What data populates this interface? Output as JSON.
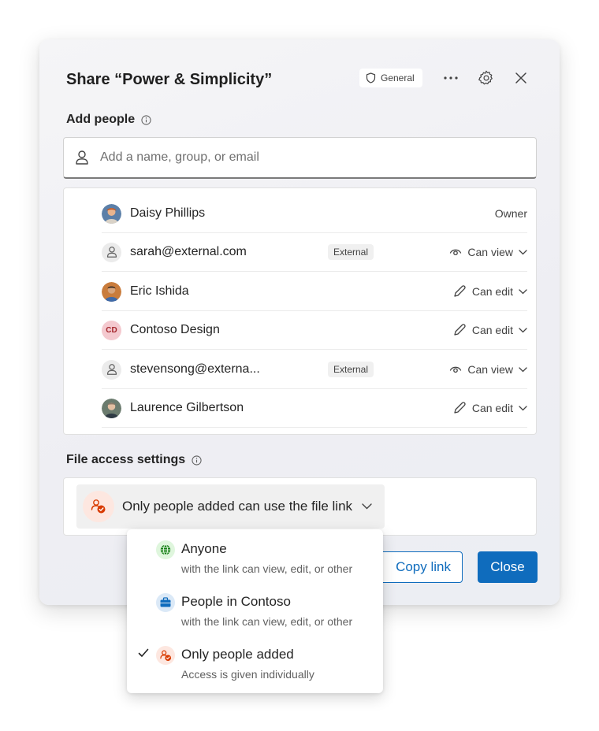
{
  "dialog": {
    "title": "Share “Power & Simplicity”",
    "sensitivity_label": "General",
    "more_icon": "more-horizontal-icon",
    "settings_icon": "gear-icon",
    "close_icon": "close-icon"
  },
  "add_people": {
    "label": "Add people",
    "placeholder": "Add a name, group, or email"
  },
  "people": [
    {
      "name": "Daisy Phillips",
      "role": "Owner",
      "avatar": "photo",
      "external": false
    },
    {
      "name": "sarah@external.com",
      "badge": "External",
      "permission": "Can view",
      "perm_icon": "eye-icon",
      "avatar": "person-icon",
      "external": true
    },
    {
      "name": "Eric Ishida",
      "permission": "Can edit",
      "perm_icon": "pencil-icon",
      "avatar": "photo",
      "external": false
    },
    {
      "name": "Contoso Design",
      "initials": "CD",
      "permission": "Can edit",
      "perm_icon": "pencil-icon",
      "avatar": "initials",
      "external": false
    },
    {
      "name": "stevensong@externa...",
      "badge": "External",
      "permission": "Can view",
      "perm_icon": "eye-icon",
      "avatar": "person-icon",
      "external": true
    },
    {
      "name": "Laurence Gilbertson",
      "permission": "Can edit",
      "perm_icon": "pencil-icon",
      "avatar": "photo",
      "external": false
    }
  ],
  "file_access": {
    "label": "File access settings",
    "selected": "Only people added can use the file link"
  },
  "buttons": {
    "copy_link": "Copy link",
    "close": "Close"
  },
  "menu": {
    "items": [
      {
        "title": "Anyone",
        "desc": "with the link can view, edit, or other",
        "icon": "globe-icon",
        "checked": false
      },
      {
        "title": "People in Contoso",
        "desc": "with the link can view, edit, or other",
        "icon": "briefcase-icon",
        "checked": false
      },
      {
        "title": "Only people added",
        "desc": "Access is given individually",
        "icon": "people-lock-icon",
        "checked": true
      }
    ]
  },
  "colors": {
    "accent": "#0f6cbd",
    "globe_bg": "#dff6dd",
    "globe_fg": "#107c10",
    "briefcase_bg": "#dbe9f7",
    "briefcase_fg": "#0f6cbd",
    "people_bg": "#fde7e0",
    "people_fg": "#d83b01",
    "cd_avatar_bg": "#f4c9cf",
    "cd_avatar_fg": "#a4262c"
  }
}
